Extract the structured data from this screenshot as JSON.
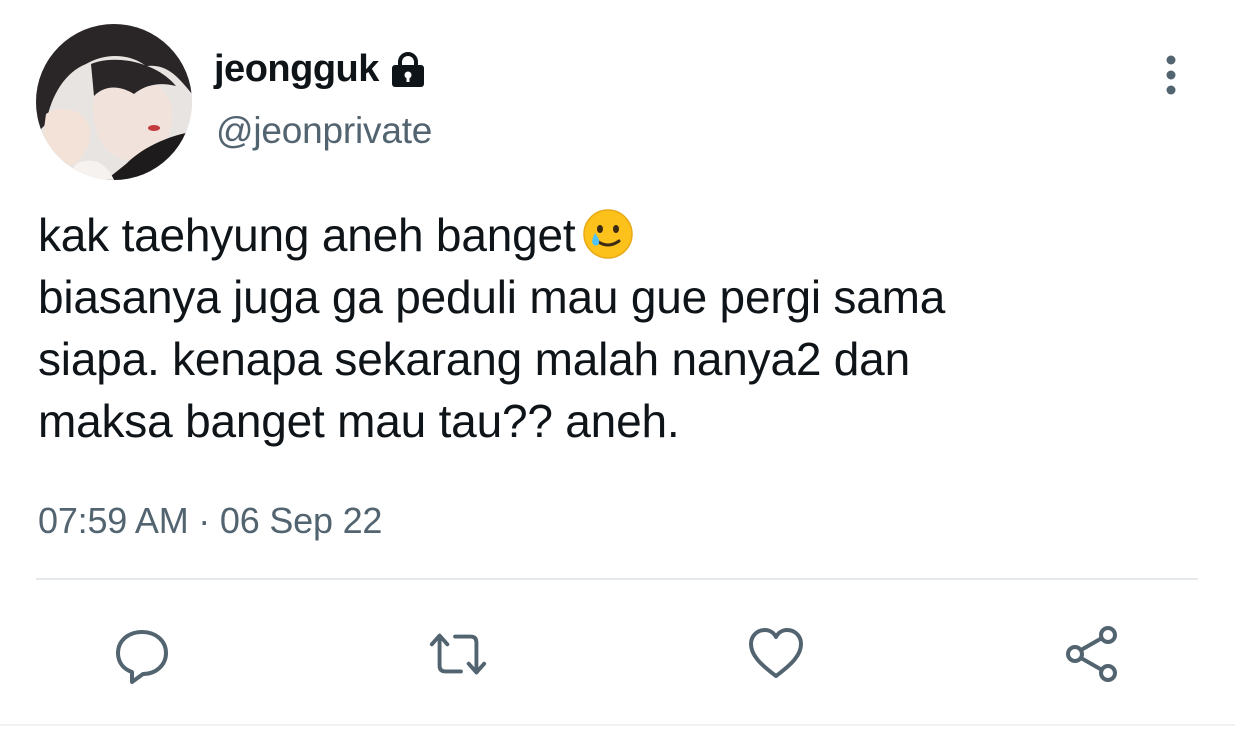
{
  "user": {
    "display_name": "jeongguk",
    "handle": "@jeonprivate",
    "avatar": "profile-photo",
    "protected_icon": "lock-icon"
  },
  "tweet": {
    "lines": [
      "kak taehyung aneh banget",
      "biasanya juga ga peduli mau gue pergi sama",
      "siapa. kenapa sekarang malah nanya2 dan",
      "maksa banget mau tau?? aneh."
    ],
    "emoji": "smiling-face-with-tear",
    "timestamp": "07:59 AM · 06 Sep 22"
  },
  "actions": [
    {
      "name": "reply",
      "icon": "reply-icon"
    },
    {
      "name": "retweet",
      "icon": "retweet-icon"
    },
    {
      "name": "like",
      "icon": "heart-icon"
    },
    {
      "name": "share",
      "icon": "share-icon"
    }
  ],
  "menu_icon": "more-vertical-icon",
  "colors": {
    "text_primary": "#0f1419",
    "text_secondary": "#536471",
    "icon": "#536471",
    "divider": "#e6e9ec",
    "emoji_face": "#fcc21b",
    "emoji_tear": "#4fc3f7"
  }
}
